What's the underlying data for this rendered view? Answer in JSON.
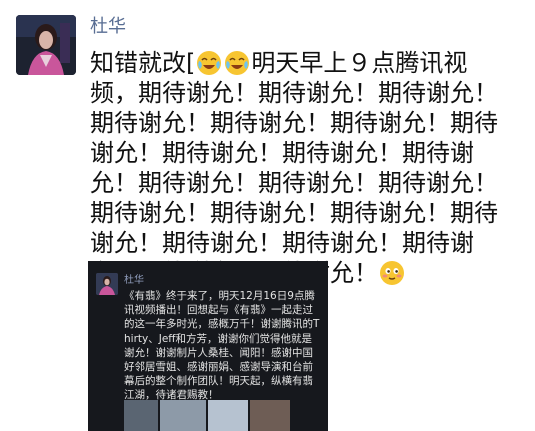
{
  "post": {
    "author": "杜华",
    "text_before_emoji": "知错就改[",
    "text_after_emoji": "明天早上９点腾讯视频，期待谢允！期待谢允！期待谢允！期待谢允！期待谢允！期待谢允！期待谢允！期待谢允！期待谢允！期待谢允！期待谢允！期待谢允！期待谢允！期待谢允！期待谢允！期待谢允！期待谢允！期待谢允！期待谢允！期待谢允！期待谢允！期待谢允！",
    "emojis_inline": [
      "laughing-crying-face-icon",
      "laughing-crying-face-icon"
    ],
    "emoji_end": "shy-smile-face-icon"
  },
  "screenshot": {
    "author": "杜华",
    "text": "《有翡》终于来了，明天12月16日9点腾讯视频播出！回想起与《有翡》一起走过的这一年多时光，感概万千！谢谢腾讯的Thirty、Jeff和方芳，谢谢你们觉得他就是谢允！谢谢制片人桑桂、闻阳！感谢中国好邻居雪姐、感谢丽娟、感谢导演和台前幕后的整个制作团队！明天起，纵横有翡江湖，待诸君赐教！"
  }
}
